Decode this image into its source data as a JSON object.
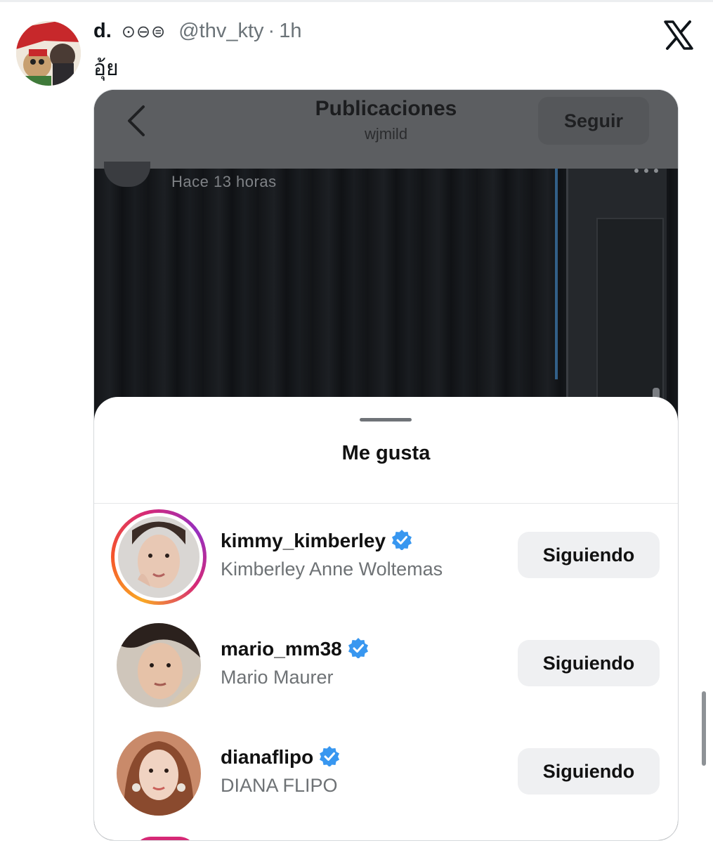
{
  "tweet": {
    "display_name": "d.",
    "name_emojis": "⊙⊖⊜",
    "handle": "@thv_kty",
    "separator": "·",
    "time": "1h",
    "text": "อุ้ย",
    "brand_icon": "x-logo-icon"
  },
  "embedded_screenshot": {
    "header": {
      "back_icon": "chevron-left-icon",
      "title": "Publicaciones",
      "subtitle": "wjmild",
      "follow_label": "Seguir"
    },
    "post": {
      "time": "Hace 13 horas",
      "more_icon": "more-horizontal-icon"
    },
    "likes_sheet": {
      "title": "Me gusta",
      "items": [
        {
          "username": "kimmy_kimberley",
          "full_name": "Kimberley Anne Woltemas",
          "button": "Siguiendo",
          "verified": true,
          "story_ring": true
        },
        {
          "username": "mario_mm38",
          "full_name": "Mario Maurer",
          "button": "Siguiendo",
          "verified": true,
          "story_ring": false
        },
        {
          "username": "dianaflipo",
          "full_name": "DIANA FLIPO",
          "button": "Siguiendo",
          "verified": true,
          "story_ring": false
        }
      ]
    }
  },
  "colors": {
    "verified_badge": "#3897f0",
    "story_ring": "#d62976",
    "header_overlay": "#5c5e61"
  }
}
